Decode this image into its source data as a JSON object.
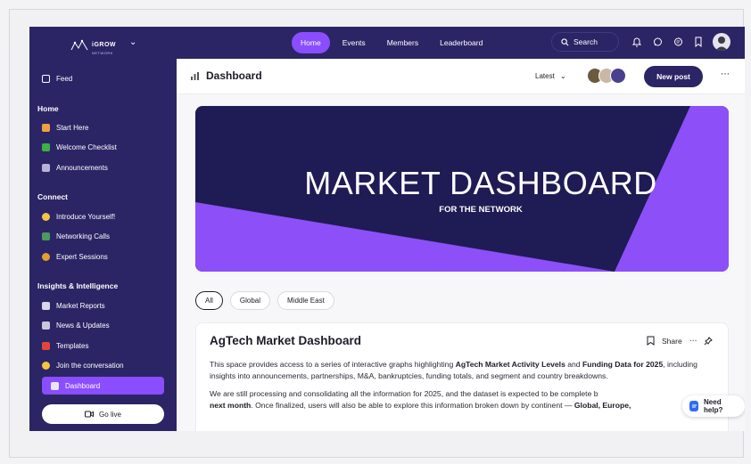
{
  "brand": {
    "name": "iGROW",
    "sub": "NETWORK"
  },
  "nav": [
    {
      "label": "Home",
      "active": true
    },
    {
      "label": "Events",
      "active": false
    },
    {
      "label": "Members",
      "active": false
    },
    {
      "label": "Leaderboard",
      "active": false
    }
  ],
  "search": {
    "label": "Search"
  },
  "sidebar": {
    "feed": "Feed",
    "sections": [
      {
        "title": "Home",
        "items": [
          "Start Here",
          "Welcome Checklist",
          "Announcements"
        ]
      },
      {
        "title": "Connect",
        "items": [
          "Introduce Yourself!",
          "Networking Calls",
          "Expert Sessions"
        ]
      },
      {
        "title": "Insights & Intelligence",
        "items": [
          "Market Reports",
          "News & Updates",
          "Templates",
          "Join the conversation",
          "Dashboard"
        ]
      }
    ],
    "go_live": "Go live"
  },
  "header": {
    "title": "Dashboard",
    "sort": "Latest",
    "new_post": "New post"
  },
  "banner": {
    "title": "MARKET DASHBOARD",
    "subtitle": "FOR THE NETWORK"
  },
  "filters": [
    "All",
    "Global",
    "Middle East"
  ],
  "post": {
    "title": "AgTech Market Dashboard",
    "share": "Share",
    "p1_a": "This space provides access to a series of interactive graphs highlighting ",
    "p1_b": "AgTech Market Activity Levels",
    "p1_c": " and ",
    "p1_d": "Funding Data for 2025",
    "p1_e": ", including insights into announcements, partnerships, M&A, bankruptcies, funding totals, and segment and country breakdowns.",
    "p2_a": "We are still processing and consolidating all the information for 2025, and the dataset is expected to be complete b",
    "p2_b": "next month",
    "p2_c": ". Once finalized, users will also be able to explore this information broken down by continent — ",
    "p2_d": "Global, Europe,"
  },
  "help": "Need help?",
  "colors": {
    "nav_bg": "#2b2566",
    "accent": "#8a4dff",
    "banner_bg": "#1f1b54"
  }
}
